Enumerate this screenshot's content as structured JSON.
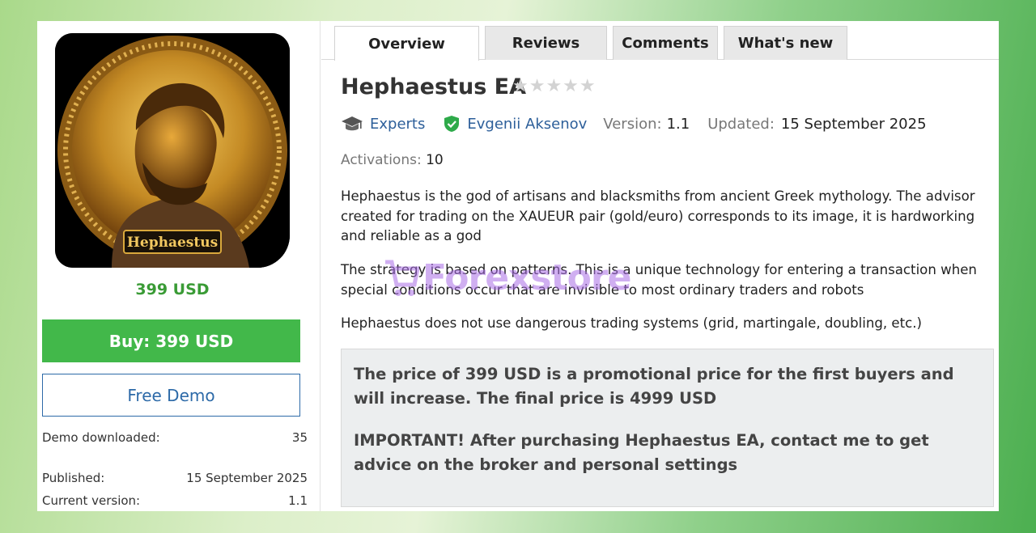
{
  "product": {
    "logo_text": "Hephaestus",
    "price": "399 USD",
    "buy_label": "Buy: 399 USD",
    "demo_label": "Free Demo",
    "meta": [
      {
        "label": "Demo downloaded:",
        "value": "35"
      },
      {
        "label": "Published:",
        "value": "15 September 2025"
      },
      {
        "label": "Current version:",
        "value": "1.1"
      }
    ]
  },
  "tabs": [
    "Overview",
    "Reviews",
    "Comments",
    "What's new"
  ],
  "header": {
    "title": "Hephaestus EA",
    "stars": "★★★★★",
    "category": "Experts",
    "author": "Evgenii Aksenov",
    "version_label": "Version:",
    "version": "1.1",
    "updated_label": "Updated:",
    "updated": "15 September 2025",
    "activations_label": "Activations:",
    "activations": "10"
  },
  "description": [
    "Hephaestus is the god of artisans and blacksmiths from ancient Greek mythology. The advisor created for trading on the XAUEUR pair (gold/euro) corresponds to its image, it is hardworking and reliable as a god",
    "The strategy is based on patterns. This is a unique technology for entering a transaction when special conditions occur that are invisible to most ordinary traders and robots",
    "Hephaestus does not use dangerous trading systems (grid, martingale, doubling, etc.)"
  ],
  "note": [
    "The price of 399 USD is a promotional price for the first buyers and will increase. The final price is 4999 USD",
    "IMPORTANT! After purchasing Hephaestus EA, contact me to get advice on the broker and personal settings"
  ],
  "watermark": "Forexstore",
  "colors": {
    "price": "#3a9b36",
    "buy": "#42b84a",
    "link": "#2d5f9a"
  }
}
